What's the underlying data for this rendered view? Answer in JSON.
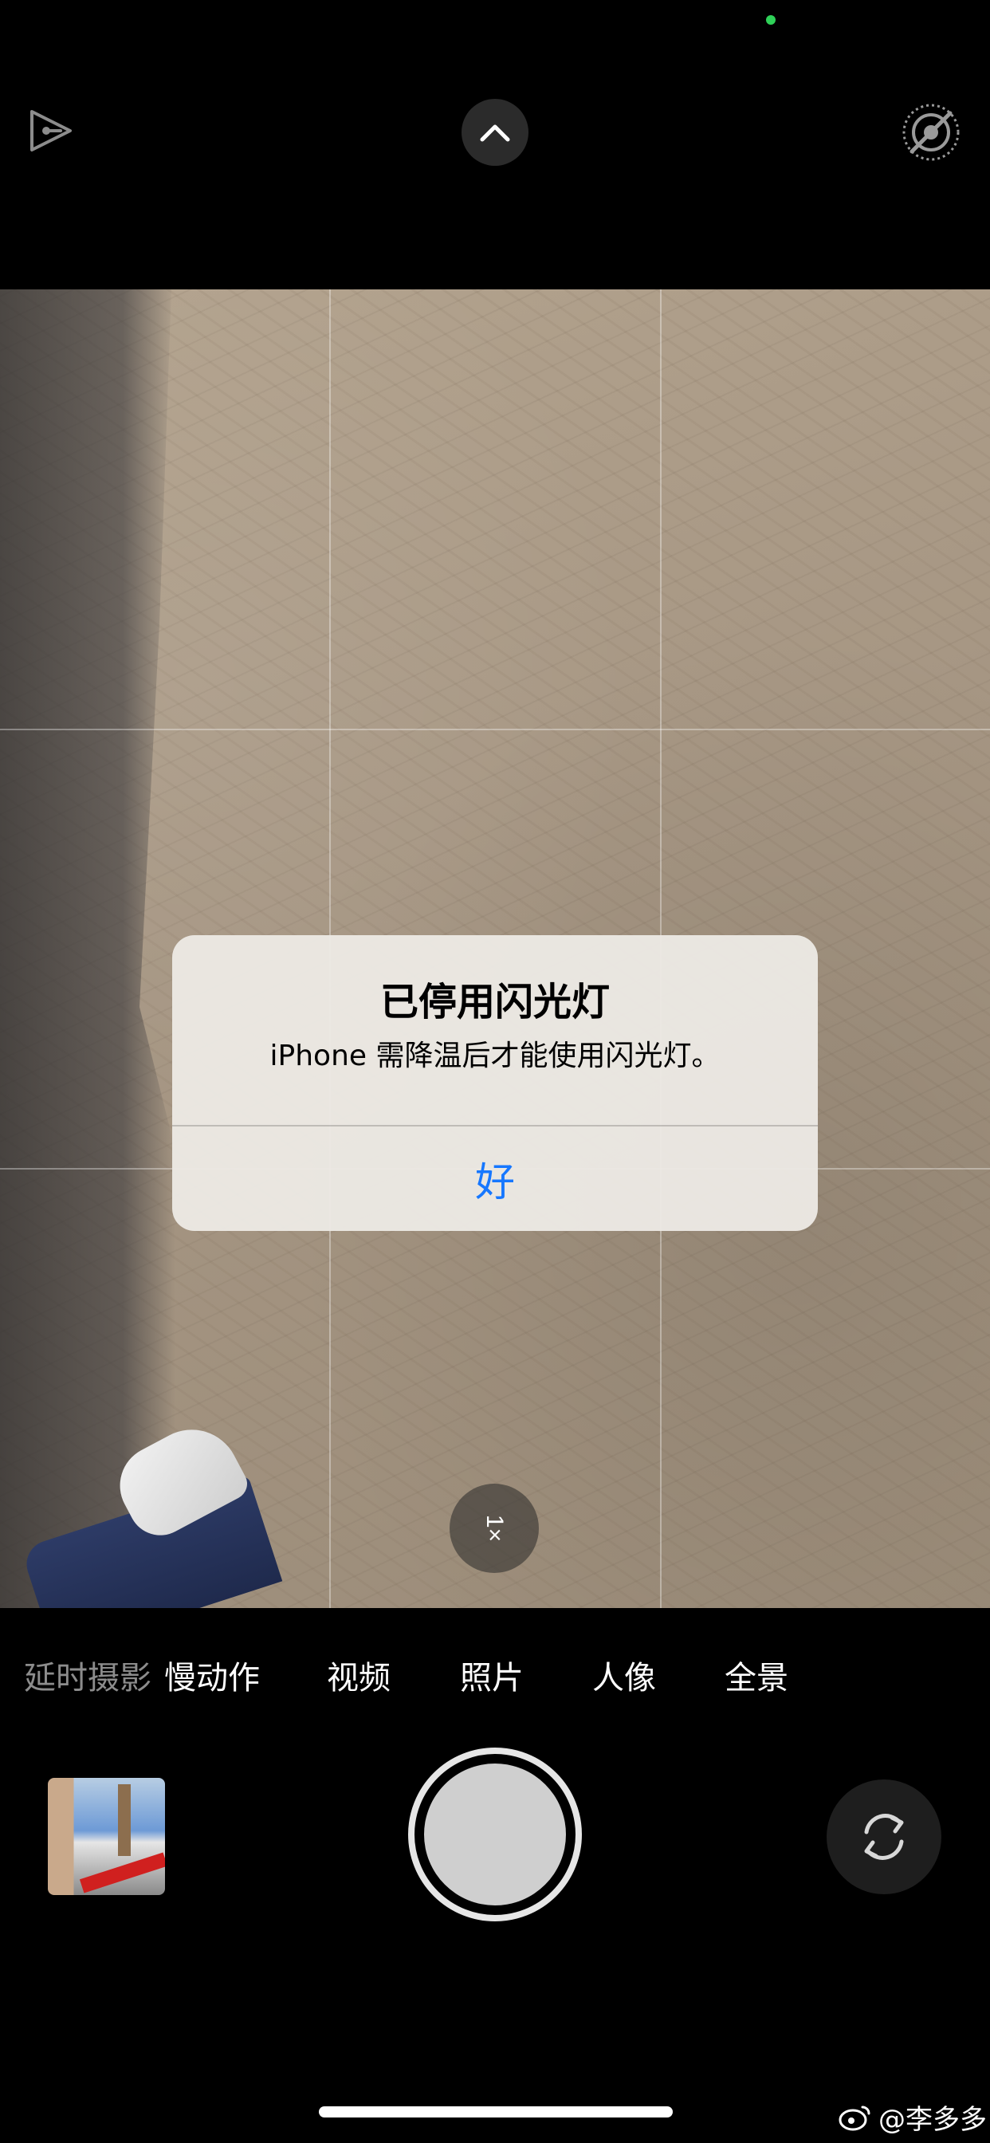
{
  "status": {
    "camera_in_use_indicator_color": "#2fd158"
  },
  "top_bar": {
    "left_icon": "flash-off-icon",
    "center_button_icon": "chevron-up-icon",
    "right_icon": "live-photo-off-icon"
  },
  "viewfinder": {
    "zoom_label": "1×"
  },
  "alert": {
    "title": "已停用闪光灯",
    "message": "iPhone 需降温后才能使用闪光灯。",
    "ok_label": "好",
    "ok_color": "#1677ff"
  },
  "modes": {
    "items": [
      {
        "label": "延时摄影",
        "state": "faded"
      },
      {
        "label": "慢动作",
        "state": "normal"
      },
      {
        "label": "视频",
        "state": "normal"
      },
      {
        "label": "照片",
        "state": "selected"
      },
      {
        "label": "人像",
        "state": "normal"
      },
      {
        "label": "全景",
        "state": "normal"
      }
    ]
  },
  "controls": {
    "thumbnail_icon": "last-photo-thumbnail",
    "shutter_icon": "shutter-button",
    "flip_icon": "flip-camera-icon"
  },
  "watermark": {
    "text": "@李多多",
    "icon": "weibo-icon"
  }
}
